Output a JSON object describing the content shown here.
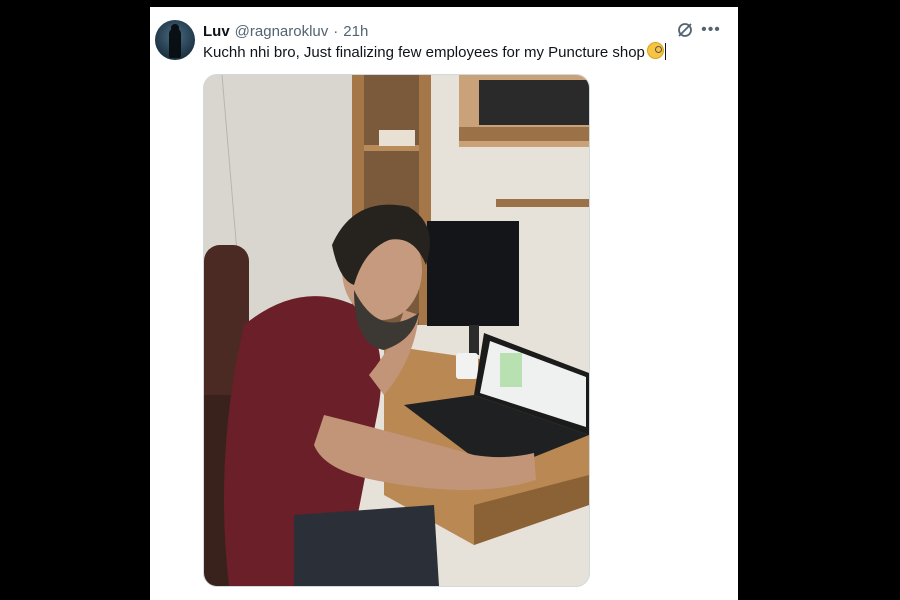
{
  "tweet": {
    "author_name": "Luv",
    "author_handle": "@ragnarokluv",
    "separator": "·",
    "time": "21h",
    "text": "Kuchh nhi bro, Just finalizing few employees for my Puncture shop",
    "emoji": "face-with-monocle",
    "media_alt": "Man with beard in maroon polo shirt at desk using laptop"
  },
  "icons": {
    "grok": "grok-icon",
    "more": "more-icon"
  }
}
